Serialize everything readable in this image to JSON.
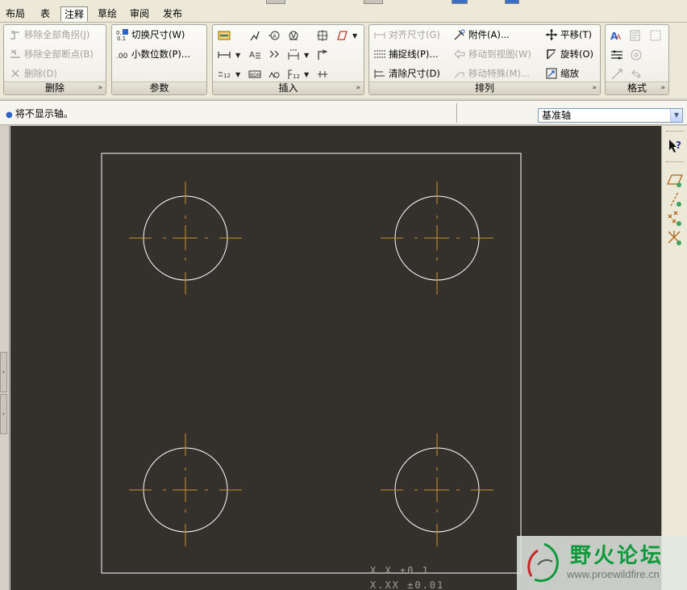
{
  "tabs": [
    {
      "label": "布局",
      "active": false
    },
    {
      "label": "表",
      "active": false
    },
    {
      "label": "注释",
      "active": true
    },
    {
      "label": "草绘",
      "active": false
    },
    {
      "label": "审阅",
      "active": false
    },
    {
      "label": "发布",
      "active": false
    }
  ],
  "groups": {
    "delete": {
      "title": "删除",
      "buttons": [
        {
          "label": "移除全部角拐(J)",
          "icon": "remove-jogs-icon",
          "enabled": false
        },
        {
          "label": "移除全部断点(B)",
          "icon": "remove-breaks-icon",
          "enabled": false
        },
        {
          "label": "删除(D)",
          "icon": "delete-x-icon",
          "enabled": false
        }
      ]
    },
    "params": {
      "title": "参数",
      "buttons": [
        {
          "label": "切换尺寸(W)",
          "icon": "toggle-dimension-icon",
          "enabled": true
        },
        {
          "label": "小数位数(P)...",
          "icon": "decimal-places-icon",
          "enabled": true
        }
      ]
    },
    "insert": {
      "title": "插入"
    },
    "arrange": {
      "title": "排列",
      "buttons": [
        {
          "label": "对齐尺寸(G)",
          "icon": "align-dimensions-icon",
          "enabled": false
        },
        {
          "label": "捕捉线(P)...",
          "icon": "snap-lines-icon",
          "enabled": true
        },
        {
          "label": "清除尺寸(D)",
          "icon": "cleanup-dimensions-icon",
          "enabled": true
        },
        {
          "label": "附件(A)...",
          "icon": "attachment-icon",
          "enabled": true
        },
        {
          "label": "移动到视图(W)",
          "icon": "move-to-view-icon",
          "enabled": false
        },
        {
          "label": "移动特殊(M)...",
          "icon": "move-special-icon",
          "enabled": false
        },
        {
          "label": "平移(T)",
          "icon": "translate-icon",
          "enabled": true
        },
        {
          "label": "旋转(O)",
          "icon": "rotate-icon",
          "enabled": true
        },
        {
          "label": "缩放",
          "icon": "scale-icon",
          "enabled": true
        }
      ]
    },
    "format": {
      "title": "格式"
    }
  },
  "message": "将不显示轴。",
  "filter": {
    "selected": "基准轴"
  },
  "drawing": {
    "tolerance_lines": [
      "X.X   ±0.1",
      "X.XX  ±0.01"
    ]
  },
  "watermark": {
    "name": "野火论坛",
    "url": "www.proewildfire.cn"
  },
  "colors": {
    "canvas_bg": "#34302b",
    "geometry": "#ffffff",
    "centerline": "#c99233",
    "ribbon_bg": "#ece9d8",
    "watermark_green": "#0e9a3c"
  }
}
